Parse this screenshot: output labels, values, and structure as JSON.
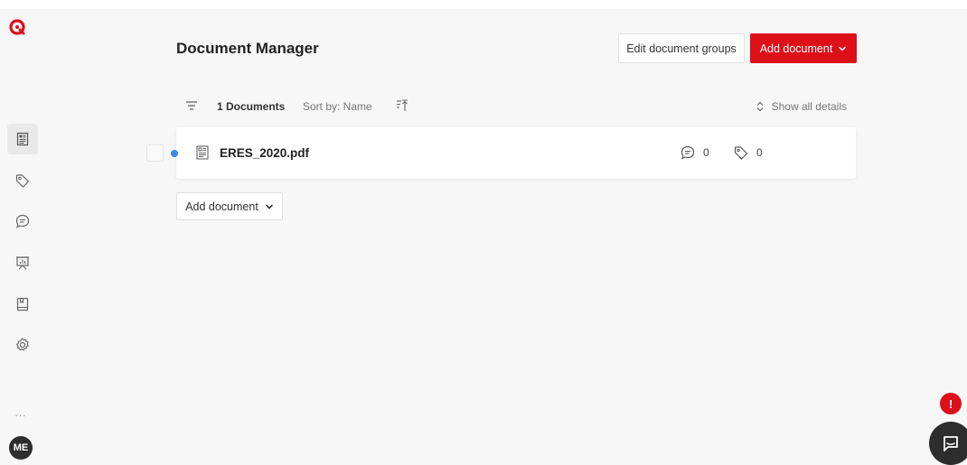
{
  "brand": {
    "logo_icon": "logo-icon",
    "accent": "#dd0f19"
  },
  "sidebar": {
    "items": [
      {
        "name": "documents",
        "icon": "document-icon",
        "active": true
      },
      {
        "name": "tags",
        "icon": "tag-icon",
        "active": false
      },
      {
        "name": "comments",
        "icon": "comment-icon",
        "active": false
      },
      {
        "name": "presentation",
        "icon": "presentation-icon",
        "active": false
      },
      {
        "name": "book",
        "icon": "book-icon",
        "active": false
      },
      {
        "name": "settings",
        "icon": "gear-icon",
        "active": false
      }
    ],
    "more_label": "...",
    "avatar_initials": "ME"
  },
  "header": {
    "title": "Document Manager",
    "edit_groups_label": "Edit document groups",
    "add_document_label": "Add document"
  },
  "toolbar": {
    "doc_count": "1 Documents",
    "sort_label": "Sort by: Name",
    "show_details_label": "Show all details"
  },
  "documents": [
    {
      "name": "ERES_2020.pdf",
      "comments": "0",
      "tags": "0",
      "unread": true
    }
  ],
  "footer": {
    "add_document_label": "Add document"
  },
  "notifications": {
    "alert_badge": "!",
    "alert_color": "#dd0f19",
    "unread_dot_color": "#3d87e6"
  }
}
